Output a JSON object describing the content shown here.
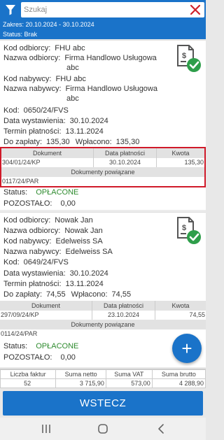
{
  "search": {
    "placeholder": "Szukaj"
  },
  "header": {
    "range": "Zakres: 20.10.2024  -  30.10.2024",
    "status": "Status: Brak"
  },
  "labels": {
    "kod_odbiorcy": "Kod odbiorcy:",
    "nazwa_odbiorcy": "Nazwa odbiorcy:",
    "kod_nabywcy": "Kod nabywcy:",
    "nazwa_nabywcy": "Nazwa nabywcy:",
    "kod": "Kod:",
    "data_wystawienia": "Data wystawienia:",
    "termin_platnosci": "Termin płatności:",
    "do_zaplaty": "Do zapłaty:",
    "wplacono": "Wpłacono:",
    "status": "Status:",
    "pozostalo": "POZOSTAŁO:",
    "dokument": "Dokument",
    "data_platnosci": "Data płatności",
    "kwota": "Kwota",
    "dokumenty_powiazane": "Dokumenty powiązane"
  },
  "invoices": [
    {
      "kod_odbiorcy": "FHU abc",
      "nazwa_odbiorcy_1": "Firma Handlowo Usługowa",
      "nazwa_odbiorcy_2": "abc",
      "kod_nabywcy": "FHU abc",
      "nazwa_nabywcy_1": "Firma Handlowo Usługowa",
      "nazwa_nabywcy_2": "abc",
      "kod": "0650/24/FVS",
      "data_wystawienia": "30.10.2024",
      "termin_platnosci": "13.11.2024",
      "do_zaplaty": "135,30",
      "wplacono": "135,30",
      "payment": {
        "dokument": "304/01/24/KP",
        "data": "30.10.2024",
        "kwota": "135,30"
      },
      "related": "0117/24/PAR",
      "status": "OPŁACONE",
      "pozostalo": "0,00"
    },
    {
      "kod_odbiorcy": "Nowak Jan",
      "nazwa_odbiorcy_1": "Nowak Jan",
      "kod_nabywcy": "Edelweiss SA",
      "nazwa_nabywcy_1": "Edelweiss SA",
      "kod": "0649/24/FVS",
      "data_wystawienia": "30.10.2024",
      "termin_platnosci": "13.11.2024",
      "do_zaplaty": "74,55",
      "wplacono": "74,55",
      "payment": {
        "dokument": "297/09/24/KP",
        "data": "23.10.2024",
        "kwota": "74,55"
      },
      "related": "0114/24/PAR",
      "status": "OPŁACONE",
      "pozostalo": "0,00"
    }
  ],
  "summary": {
    "headers": [
      "Liczba faktur",
      "Suma netto",
      "Suma VAT",
      "Suma brutto"
    ],
    "values": [
      "52",
      "3 715,90",
      "573,00",
      "4 288,90"
    ]
  },
  "fab": {
    "label": "+"
  },
  "back_button": {
    "label": "WSTECZ"
  },
  "colors": {
    "primary": "#1a73c9",
    "paid": "#2e8b2e",
    "highlight": "#d01a2a",
    "check": "#2e9e4a"
  },
  "icons": [
    "filter-icon",
    "close-icon",
    "invoice-paid-icon",
    "plus-icon",
    "recent-apps-icon",
    "home-icon",
    "back-icon"
  ]
}
